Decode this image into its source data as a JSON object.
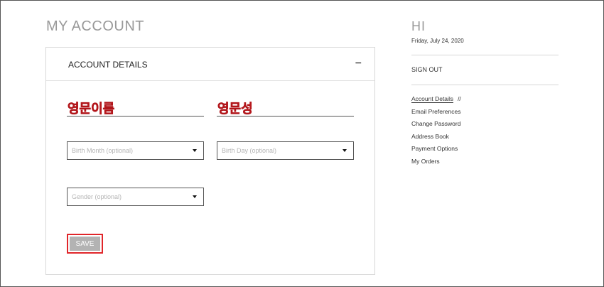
{
  "page": {
    "title": "MY ACCOUNT"
  },
  "panel": {
    "title": "ACCOUNT DETAILS",
    "collapse_symbol": "−"
  },
  "form": {
    "first_name_value": "영문이름",
    "last_name_value": "영문성",
    "birth_month_placeholder": "Birth Month (optional)",
    "birth_day_placeholder": "Birth Day (optional)",
    "gender_placeholder": "Gender (optional)",
    "save_label": "SAVE"
  },
  "sidebar": {
    "greeting": "HI",
    "date": "Friday, July 24, 2020",
    "sign_out": "SIGN OUT",
    "active_separator": "//",
    "items": [
      {
        "label": "Account Details"
      },
      {
        "label": "Email Preferences"
      },
      {
        "label": "Change Password"
      },
      {
        "label": "Address Book"
      },
      {
        "label": "Payment Options"
      },
      {
        "label": "My Orders"
      }
    ]
  },
  "colors": {
    "highlight_red": "#e0262a",
    "save_button_bg": "#b3b3b3",
    "title_gray": "#999999"
  },
  "icons": {
    "collapse": "minus-icon",
    "dropdown": "caret-down-icon"
  }
}
